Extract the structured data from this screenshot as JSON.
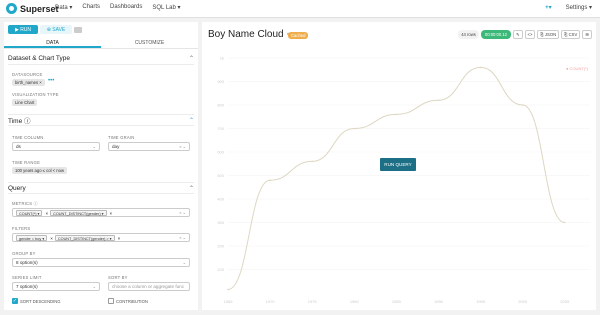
{
  "nav": {
    "brand": "Superset",
    "menu": [
      "Data ▾",
      "Charts",
      "Dashboards",
      "SQL Lab ▾"
    ],
    "right_plus": "+▾",
    "settings": "Settings ▾"
  },
  "toolbar": {
    "run_label": "▶ RUN",
    "save_label": "⊕ SAVE"
  },
  "tabs": [
    "DATA",
    "CUSTOMIZE"
  ],
  "sections": {
    "dataset": {
      "title": "Dataset & Chart Type",
      "datasource_label": "DATASOURCE",
      "datasource_value": "birth_names ×",
      "datasource_more": "•••",
      "viz_label": "VISUALIZATION TYPE",
      "viz_value": "Line Chart"
    },
    "time": {
      "title": "Time ⓘ",
      "time_column_label": "TIME COLUMN",
      "time_column_value": "ds",
      "time_grain_label": "TIME GRAIN",
      "time_grain_value": "day",
      "time_range_label": "TIME RANGE",
      "time_range_value": "100 years ago ≤ col < now"
    },
    "query": {
      "title": "Query",
      "metrics_label": "METRICS ⓘ",
      "metrics": [
        "COUNT(*) ▾",
        "COUNT_DISTINCT(gender) ▾"
      ],
      "filters_label": "FILTERS",
      "filters": [
        "gender = boy ▾",
        "COUNT_DISTINCT(gender) > ▾"
      ],
      "groupby_label": "GROUP BY",
      "groupby_value": "8 option(s)",
      "series_limit_label": "SERIES LIMIT",
      "series_limit_value": "7 option(s)",
      "sort_by_label": "SORT BY",
      "sort_by_placeholder": "choose a column or aggregate func",
      "sort_desc_label": "SORT DESCENDING",
      "contribution_label": "CONTRIBUTION"
    }
  },
  "chart": {
    "title": "Boy Name Cloud",
    "title_edit_icon": "✎",
    "badge": "Cached",
    "rows": "44 rows",
    "timer": "00:00:00.12",
    "actions": [
      "✎",
      "<>",
      "⎘ JSON",
      "⎘ CSV",
      "☰"
    ],
    "run_query_label": "RUN QUERY",
    "legend_note": "● COUNT(*)"
  },
  "chart_data": {
    "type": "line",
    "x": [
      1965,
      1970,
      1975,
      1980,
      1985,
      1990,
      1995,
      2000,
      2005
    ],
    "xlim": [
      1965,
      2008
    ],
    "y_ticks": [
      "1k",
      "900",
      "800",
      "700",
      "600",
      "500",
      "400",
      "300",
      "200",
      "100"
    ],
    "series": [
      {
        "values": [
          15,
          480,
          560,
          700,
          760,
          820,
          960,
          800,
          300
        ]
      },
      {
        "values": [
          5,
          8,
          10,
          12,
          13,
          14,
          12,
          10,
          6
        ]
      }
    ],
    "grid": true
  }
}
